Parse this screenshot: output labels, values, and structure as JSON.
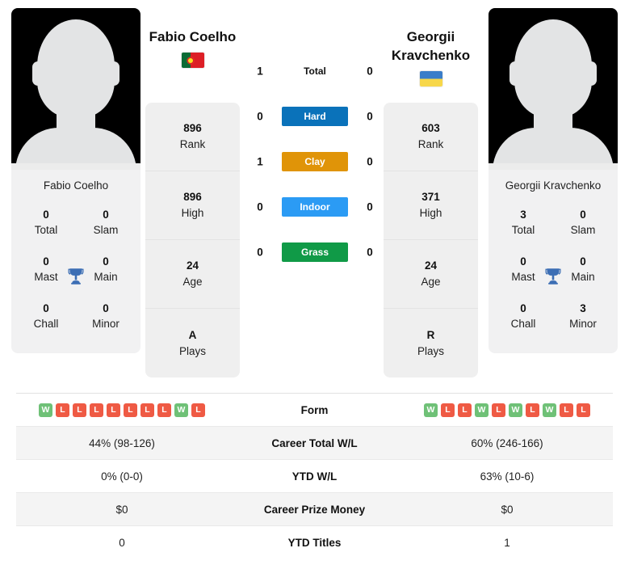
{
  "theme": {
    "hard_color": "#0a72ba",
    "clay_color": "#e09408",
    "indoor_color": "#2b9bf4",
    "grass_color": "#109a47",
    "win_color": "#6fc177",
    "loss_color": "#ef5a44",
    "trophy_color": "#3c6eb4"
  },
  "players": {
    "left": {
      "name": "Fabio Coelho",
      "flag": "portugal-flag",
      "card_name": "Fabio Coelho",
      "titles": [
        {
          "num": "0",
          "label": "Total"
        },
        {
          "num": "0",
          "label": "Slam"
        },
        {
          "num": "0",
          "label": "Mast"
        },
        {
          "num": "0",
          "label": "Main"
        },
        {
          "num": "0",
          "label": "Chall"
        },
        {
          "num": "0",
          "label": "Minor"
        }
      ],
      "info": [
        {
          "num": "896",
          "label": "Rank"
        },
        {
          "num": "896",
          "label": "High"
        },
        {
          "num": "24",
          "label": "Age"
        },
        {
          "num": "A",
          "label": "Plays"
        }
      ],
      "form": [
        "W",
        "L",
        "L",
        "L",
        "L",
        "L",
        "L",
        "L",
        "W",
        "L"
      ]
    },
    "right": {
      "name": "Georgii Kravchenko",
      "flag": "ukraine-flag",
      "card_name": "Georgii Kravchenko",
      "titles": [
        {
          "num": "3",
          "label": "Total"
        },
        {
          "num": "0",
          "label": "Slam"
        },
        {
          "num": "0",
          "label": "Mast"
        },
        {
          "num": "0",
          "label": "Main"
        },
        {
          "num": "0",
          "label": "Chall"
        },
        {
          "num": "3",
          "label": "Minor"
        }
      ],
      "info": [
        {
          "num": "603",
          "label": "Rank"
        },
        {
          "num": "371",
          "label": "High"
        },
        {
          "num": "24",
          "label": "Age"
        },
        {
          "num": "R",
          "label": "Plays"
        }
      ],
      "form": [
        "W",
        "L",
        "L",
        "W",
        "L",
        "W",
        "L",
        "W",
        "L",
        "L"
      ]
    }
  },
  "h2h": [
    {
      "label": "Total",
      "left": "1",
      "right": "0",
      "kind": "total"
    },
    {
      "label": "Hard",
      "left": "0",
      "right": "0",
      "kind": "hard"
    },
    {
      "label": "Clay",
      "left": "1",
      "right": "0",
      "kind": "clay"
    },
    {
      "label": "Indoor",
      "left": "0",
      "right": "0",
      "kind": "indoor"
    },
    {
      "label": "Grass",
      "left": "0",
      "right": "0",
      "kind": "grass"
    }
  ],
  "stats": {
    "form_label": "Form",
    "rows": [
      {
        "label": "Career Total W/L",
        "left": "44% (98-126)",
        "right": "60% (246-166)"
      },
      {
        "label": "YTD W/L",
        "left": "0% (0-0)",
        "right": "63% (10-6)"
      },
      {
        "label": "Career Prize Money",
        "left": "$0",
        "right": "$0"
      },
      {
        "label": "YTD Titles",
        "left": "0",
        "right": "1"
      }
    ]
  }
}
